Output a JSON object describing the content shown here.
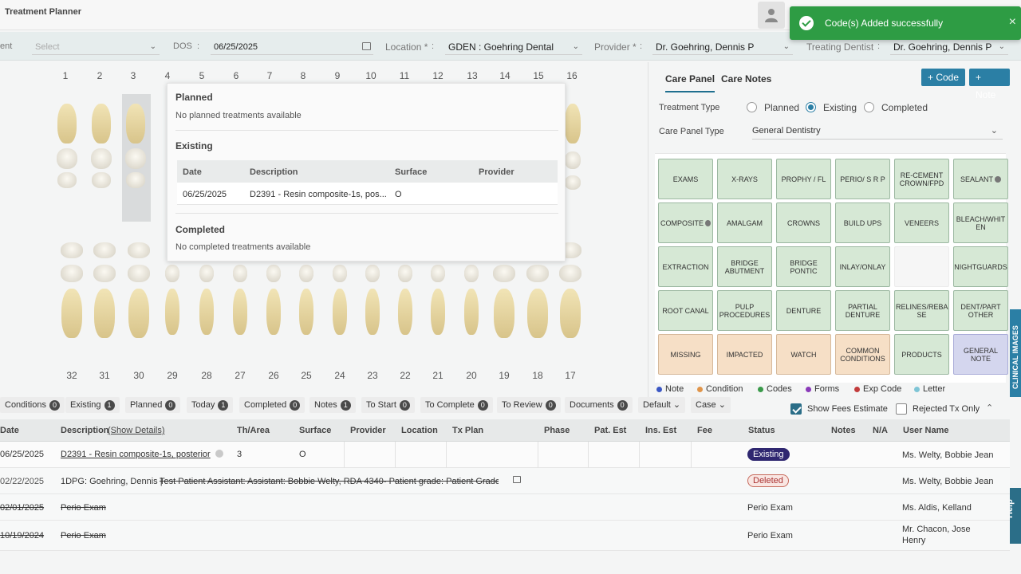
{
  "window": {
    "title": "Treatment Planner"
  },
  "toast": {
    "message": "Code(s) Added successfully",
    "close": "×"
  },
  "filters": {
    "appointment_partial": "ent",
    "appointment_placeholder": "Select",
    "dos_label": "DOS",
    "dos_value": "06/25/2025",
    "location_label": "Location *",
    "location_value": "GDEN : Goehring Dental",
    "provider_label": "Provider *",
    "provider_value": "Dr. Goehring, Dennis P",
    "treating_label": "Treating Dentist",
    "treating_value": "Dr. Goehring, Dennis P",
    "colon": ":"
  },
  "teeth": {
    "upper": [
      "1",
      "2",
      "3",
      "4",
      "5",
      "6",
      "7",
      "8",
      "9",
      "10",
      "11",
      "12",
      "13",
      "14",
      "15",
      "16"
    ],
    "lower": [
      "32",
      "31",
      "30",
      "29",
      "28",
      "27",
      "26",
      "25",
      "24",
      "23",
      "22",
      "21",
      "20",
      "19",
      "18",
      "17"
    ]
  },
  "popup": {
    "planned_title": "Planned",
    "planned_empty": "No planned treatments available",
    "existing_title": "Existing",
    "columns": [
      "Date",
      "Description",
      "Surface",
      "Provider"
    ],
    "rows": [
      {
        "date": "06/25/2025",
        "description": "D2391 - Resin composite-1s, pos...",
        "surface": "O",
        "provider": ""
      }
    ],
    "completed_title": "Completed",
    "completed_empty": "No completed treatments available"
  },
  "care_panel": {
    "tabs": [
      "Care Panel",
      "Care Notes"
    ],
    "add_code": "+ Code",
    "add_note": "+ Note",
    "treatment_type_label": "Treatment Type",
    "treatment_types": [
      "Planned",
      "Existing",
      "Completed"
    ],
    "selected_type": "Existing",
    "panel_type_label": "Care Panel Type",
    "panel_type_value": "General Dentistry",
    "buttons": [
      [
        "EXAMS",
        "X-RAYS",
        "PROPHY / FL",
        "PERIO/ S R P",
        "RE-CEMENT CROWN/FPD",
        "SEALANT"
      ],
      [
        "COMPOSITE",
        "AMALGAM",
        "CROWNS",
        "BUILD UPS",
        "VENEERS",
        "BLEACH/WHIT EN"
      ],
      [
        "EXTRACTION",
        "BRIDGE ABUTMENT",
        "BRIDGE PONTIC",
        "INLAY/ONLAY",
        "",
        "NIGHTGUARDS"
      ],
      [
        "ROOT CANAL",
        "PULP PROCEDURES",
        "DENTURE",
        "PARTIAL DENTURE",
        "RELINES/REBA SE",
        "DENT/PART OTHER"
      ],
      [
        "MISSING",
        "IMPACTED",
        "WATCH",
        "COMMON CONDITIONS",
        "PRODUCTS",
        "GENERAL NOTE"
      ]
    ],
    "legend": [
      {
        "label": "Note",
        "color": "#3b57c4"
      },
      {
        "label": "Condition",
        "color": "#e0954a"
      },
      {
        "label": "Codes",
        "color": "#3a9a4a"
      },
      {
        "label": "Forms",
        "color": "#8a3ab9"
      },
      {
        "label": "Exp Code",
        "color": "#c23c3c"
      },
      {
        "label": "Letter",
        "color": "#7fc5d6"
      }
    ]
  },
  "side": {
    "clinical_images": "CLINICAL IMAGES",
    "help": "Help"
  },
  "chips": [
    {
      "label": "Conditions",
      "count": "0"
    },
    {
      "label": "Existing",
      "count": "1"
    },
    {
      "label": "Planned",
      "count": "0"
    },
    {
      "label": "Today",
      "count": "1"
    },
    {
      "label": "Completed",
      "count": "0"
    },
    {
      "label": "Notes",
      "count": "1"
    },
    {
      "label": "To Start",
      "count": "0"
    },
    {
      "label": "To Complete",
      "count": "0"
    },
    {
      "label": "To Review",
      "count": "0"
    },
    {
      "label": "Documents",
      "count": "0"
    }
  ],
  "dropdowns": {
    "default": "Default",
    "case": "Case"
  },
  "options": {
    "show_fees": "Show Fees Estimate",
    "rejected_only": "Rejected Tx Only"
  },
  "table": {
    "columns": [
      "Date",
      "Description",
      "(Show Details)",
      "Th/Area",
      "Surface",
      "Provider",
      "Location",
      "Tx Plan",
      "Phase",
      "Pat. Est",
      "Ins. Est",
      "Fee",
      "Status",
      "Notes",
      "N/A",
      "User Name"
    ],
    "rows": [
      {
        "date": "06/25/2025",
        "description": "D2391 - Resin composite-1s, posterior",
        "area": "3",
        "surface": "O",
        "status": "Existing",
        "user": "Ms. Welty, Bobbie Jean"
      },
      {
        "date": "02/22/2025",
        "description_a": "1DPG: Goehring, Dennis |",
        "description_b": "Test Patient Assistant: Assistant: Bobbie Welty, RDA 4340- Patient grade: Patient Grade: I",
        "status": "Deleted",
        "user": "Ms. Welty, Bobbie Jean"
      },
      {
        "date": "02/01/2025",
        "description": "Perio Exam",
        "status": "Perio Exam",
        "user": "Ms. Aldis, Kelland"
      },
      {
        "date": "10/19/2024",
        "description": "Perio Exam",
        "status": "Perio Exam",
        "user_a": "Mr. Chacon, Jose",
        "user_b": "Henry"
      }
    ]
  }
}
